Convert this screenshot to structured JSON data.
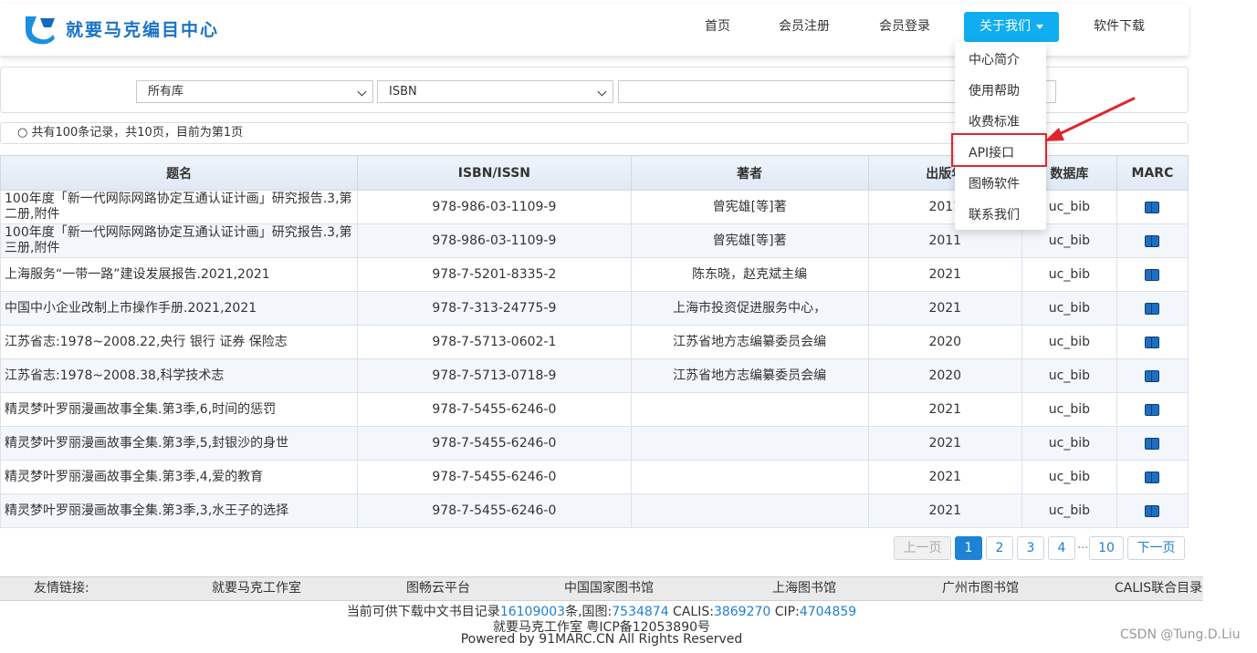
{
  "header": {
    "brand": "就要马克编目中心",
    "nav": {
      "home": "首页",
      "register": "会员注册",
      "login": "会员登录",
      "about": "关于我们",
      "download": "软件下载"
    }
  },
  "about_menu": {
    "items": [
      "中心简介",
      "使用帮助",
      "收费标准",
      "API接口",
      "图畅软件",
      "联系我们"
    ]
  },
  "search": {
    "library_select": "所有库",
    "field_select": "ISBN",
    "query_value": ""
  },
  "info": "○ 共有100条记录，共10页，目前为第1页",
  "table": {
    "headers": [
      "题名",
      "ISBN/ISSN",
      "著者",
      "出版年",
      "数据库",
      "MARC"
    ],
    "rows": [
      {
        "title": "100年度「新一代网际网路协定互通认证计画」研究报告.3,第二册,附件",
        "isbn": "978-986-03-1109-9",
        "author": "曾宪雄[等]著",
        "year": "2011",
        "db": "uc_bib"
      },
      {
        "title": "100年度「新一代网际网路协定互通认证计画」研究报告.3,第三册,附件",
        "isbn": "978-986-03-1109-9",
        "author": "曾宪雄[等]著",
        "year": "2011",
        "db": "uc_bib"
      },
      {
        "title": "上海服务“一带一路”建设发展报告.2021,2021",
        "isbn": "978-7-5201-8335-2",
        "author": "陈东晓，赵克斌主编",
        "year": "2021",
        "db": "uc_bib"
      },
      {
        "title": "中国中小企业改制上市操作手册.2021,2021",
        "isbn": "978-7-313-24775-9",
        "author": "上海市投资促进服务中心，",
        "year": "2021",
        "db": "uc_bib"
      },
      {
        "title": "江苏省志:1978~2008.22,央行 银行 证券 保险志",
        "isbn": "978-7-5713-0602-1",
        "author": "江苏省地方志编纂委员会编",
        "year": "2020",
        "db": "uc_bib"
      },
      {
        "title": "江苏省志:1978~2008.38,科学技术志",
        "isbn": "978-7-5713-0718-9",
        "author": "江苏省地方志编纂委员会编",
        "year": "2020",
        "db": "uc_bib"
      },
      {
        "title": "精灵梦叶罗丽漫画故事全集.第3季,6,时间的惩罚",
        "isbn": "978-7-5455-6246-0",
        "author": "",
        "year": "2021",
        "db": "uc_bib"
      },
      {
        "title": "精灵梦叶罗丽漫画故事全集.第3季,5,封银沙的身世",
        "isbn": "978-7-5455-6246-0",
        "author": "",
        "year": "2021",
        "db": "uc_bib"
      },
      {
        "title": "精灵梦叶罗丽漫画故事全集.第3季,4,爱的教育",
        "isbn": "978-7-5455-6246-0",
        "author": "",
        "year": "2021",
        "db": "uc_bib"
      },
      {
        "title": "精灵梦叶罗丽漫画故事全集.第3季,3,水王子的选择",
        "isbn": "978-7-5455-6246-0",
        "author": "",
        "year": "2021",
        "db": "uc_bib"
      }
    ]
  },
  "pagination": {
    "prev": "上一页",
    "pages": [
      "1",
      "2",
      "3",
      "4"
    ],
    "ellipsis": "...",
    "last": "10",
    "next": "下一页"
  },
  "footer": {
    "links_label": "友情链接:",
    "links": [
      "就要马克工作室",
      "图畅云平台",
      "中国国家图书馆",
      "上海图书馆",
      "广州市图书馆",
      "CALIS联合目录"
    ],
    "stats_prefix": "当前可供下载中文书目记录",
    "stats_total": "16109003",
    "stats_mid1": "条,国图:",
    "stats_nlc": "7534874",
    "stats_mid2": " CALIS:",
    "stats_calis": "3869270",
    "stats_mid3": " CIP:",
    "stats_cip": "4704859",
    "icp": "就要马克工作室 粤ICP备12053890号",
    "powered": "Powered by 91MARC.CN All Rights Reserved"
  },
  "watermark": "CSDN @Tung.D.Liu",
  "colors": {
    "accent": "#10aef0",
    "highlight": "#e0262b",
    "link": "#1f7fd1"
  }
}
